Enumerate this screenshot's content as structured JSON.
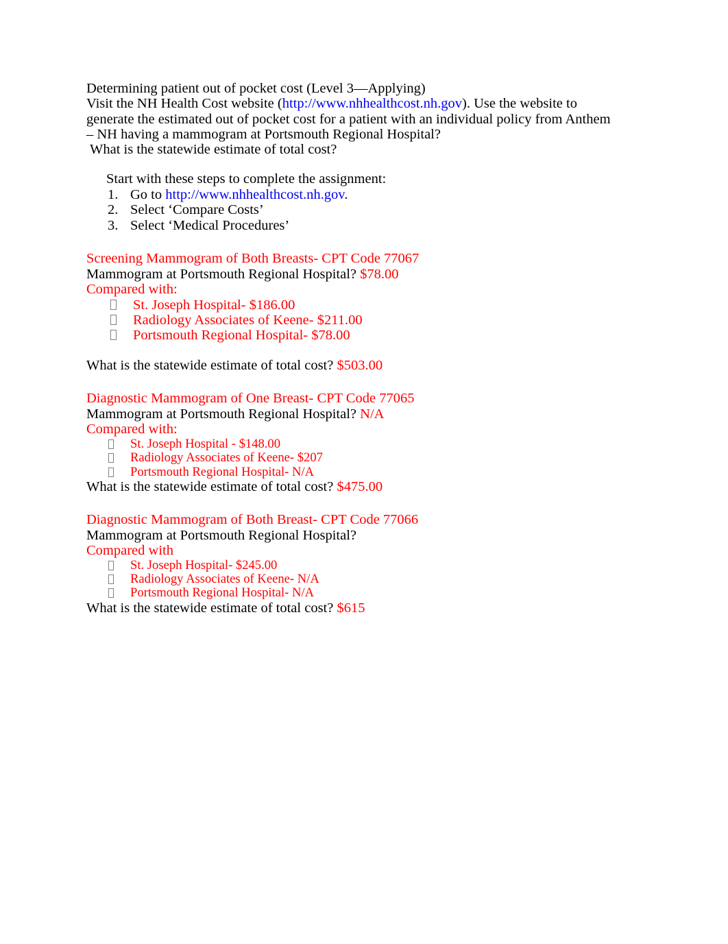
{
  "document": {
    "intro": {
      "title_line": "Determining patient out of pocket cost (Level 3—Applying)",
      "visit_prefix": "Visit the NH Health Cost website (",
      "visit_link": "http://www.nhhealthcost.nh.gov",
      "visit_suffix": "). Use the website to generate the estimated out of pocket cost for a patient with an individual policy from Anthem – NH having a mammogram at Portsmouth Regional Hospital?",
      "top_question": "What is the statewide estimate of total cost?"
    },
    "steps": {
      "heading": "Start with these steps to complete the assignment:",
      "items": [
        {
          "number": "1.",
          "prefix": "Go to ",
          "link": "http://www.nhhealthcost.nh.gov",
          "suffix": "."
        },
        {
          "number": "2.",
          "prefix": "Select ‘Compare Costs’",
          "link": "",
          "suffix": ""
        },
        {
          "number": "3.",
          "prefix": "Select ‘Medical Procedures’",
          "link": "",
          "suffix": ""
        }
      ]
    },
    "sections": [
      {
        "heading": "Screening Mammogram of Both Breasts- CPT Code 77067",
        "question_label": "Mammogram at Portsmouth Regional Hospital?",
        "question_value": "$78.00",
        "compared_label": "Compared with:",
        "bullets": [
          "St. Joseph Hospital- $186.00",
          "Radiology Associates of Keene- $211.00",
          "Portsmouth Regional Hospital- $78.00"
        ],
        "statewide_label": "What is the statewide estimate of total cost?",
        "statewide_value": "$503.00"
      },
      {
        "heading": "Diagnostic Mammogram of One Breast- CPT Code 77065",
        "question_label": "Mammogram at Portsmouth Regional Hospital?",
        "question_value": "N/A",
        "compared_label": "Compared with:",
        "bullets": [
          "St. Joseph Hospital - $148.00",
          "Radiology Associates of Keene- $207",
          "Portsmouth Regional Hospital- N/A"
        ],
        "statewide_label": "What is the statewide estimate of total cost?",
        "statewide_value": "$475.00"
      },
      {
        "heading": "Diagnostic Mammogram of Both Breast- CPT Code 77066",
        "question_label": "Mammogram at Portsmouth Regional Hospital?",
        "question_value": "",
        "compared_label": "Compared with",
        "bullets": [
          "St. Joseph Hospital- $245.00",
          "Radiology Associates of Keene- N/A",
          "Portsmouth Regional Hospital- N/A"
        ],
        "statewide_label": "What is the statewide estimate of total cost?",
        "statewide_value": "$615"
      }
    ],
    "colors": {
      "red": "#FF0000",
      "link_blue": "#0000EE",
      "text_black": "#000000",
      "page_background": "#FFFFFF"
    }
  }
}
